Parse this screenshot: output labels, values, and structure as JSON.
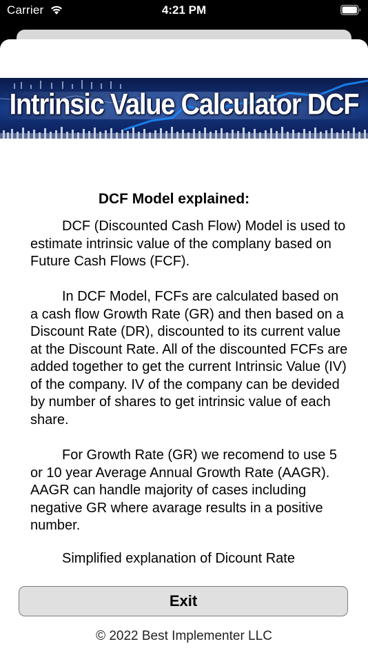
{
  "status_bar": {
    "carrier": "Carrier",
    "time": "4:21 PM",
    "wifi_icon": "wifi-icon",
    "battery_icon": "battery-icon"
  },
  "banner": {
    "title": "Intrinsic Value Calculator DCF",
    "colors": {
      "background_top": "#0a1a4a",
      "background_mid": "#163a86",
      "accent_line": "#1a8cff"
    }
  },
  "content": {
    "heading": "DCF Model explained:",
    "paragraphs": [
      "DCF (Discounted Cash Flow) Model is used to estimate intrinsic value of the complany based on Future Cash Flows (FCF).",
      "In DCF Model, FCFs are calculated based on a cash flow Growth Rate (GR) and then based on a Discount Rate (DR), discounted to its current value at the Discount Rate. All of the discounted FCFs are added together to get the current Intrinsic Value (IV) of the company. IV of the company can be devided by number of shares to get intrinsic value of each share.",
      "For Growth Rate (GR) we recomend to use 5 or 10 year Average Annual Growth Rate (AAGR). AAGR can handle majority of cases including negative GR where avarage results in a positive number.",
      "Simplified explanation of Dicount Rate"
    ]
  },
  "exit_button": {
    "label": "Exit"
  },
  "footer": {
    "copyright": "© 2022 Best Implementer LLC"
  }
}
